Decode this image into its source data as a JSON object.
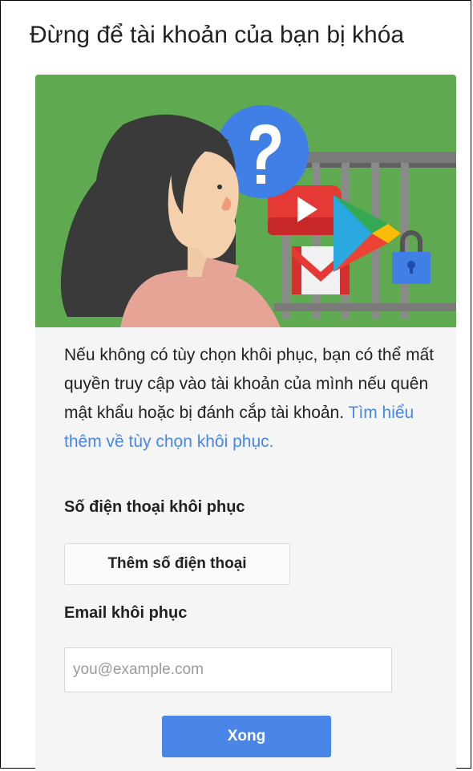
{
  "page": {
    "title": "Đừng để tài khoản của bạn bị khóa"
  },
  "colors": {
    "hero_background": "#5faa51",
    "link": "#4a86e8",
    "primary_button": "#4a86e8",
    "card_background": "#f5f5f5"
  },
  "illustration": {
    "icons": [
      "woman-thinking-icon",
      "question-mark-bubble-icon",
      "youtube-icon",
      "play-store-icon",
      "gmail-icon",
      "cage-icon",
      "padlock-icon"
    ]
  },
  "description": {
    "text": "Nếu không có tùy chọn khôi phục, bạn có thể mất quyền truy cập vào tài khoản của mình nếu quên mật khẩu hoặc bị đánh cắp tài khoản.",
    "link": "Tìm hiểu thêm về tùy chọn khôi phục."
  },
  "phone": {
    "label": "Số điện thoại khôi phục",
    "add_button": "Thêm số điện thoại"
  },
  "email": {
    "label": "Email khôi phục",
    "placeholder": "you@example.com",
    "value": ""
  },
  "actions": {
    "done": "Xong"
  }
}
